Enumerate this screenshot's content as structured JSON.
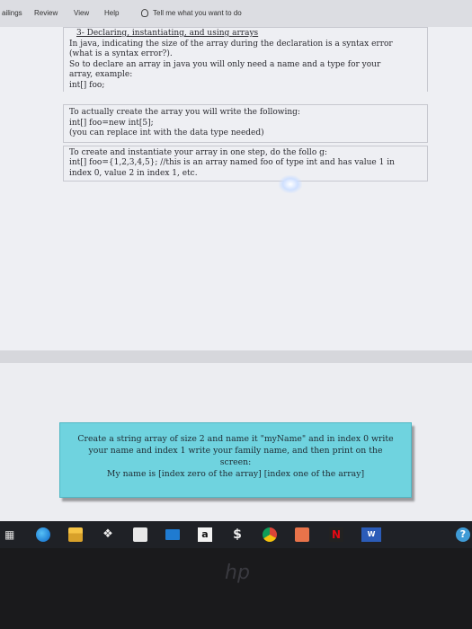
{
  "ribbon": {
    "tabs": [
      "ailings",
      "Review",
      "View",
      "Help"
    ],
    "tell_me": "Tell me what you want to do"
  },
  "document": {
    "title": "3- Declaring, instantiating, and using arrays",
    "para1": [
      "In java, indicating the size of the array during the declaration is a syntax error",
      "(what is a syntax error?).",
      "So to declare an array in java you will only need a name and a type for your",
      "array, example:",
      "int[] foo;"
    ],
    "para2": [
      "To actually create the array you will write the following:",
      "int[] foo=new int[5];",
      "(you can replace int with the data type needed)"
    ],
    "para3": [
      "To create and instantiate your array in one step, do the follo    g:",
      "int[] foo={1,2,3,4,5}; //this is an array named foo of type int and has value 1 in",
      "index 0, value 2 in index 1, etc."
    ]
  },
  "task_box": {
    "lines": [
      "Create a string array of size 2 and name it \"myName\" and in index 0 write",
      "your name and index 1 write your family name, and then print on the",
      "screen:",
      "My name is [index zero of the array] [index one of the array]"
    ]
  },
  "taskbar": {
    "icons": [
      "task-view-icon",
      "edge-icon",
      "file-explorer-icon",
      "dropbox-icon",
      "store-icon",
      "mail-icon",
      "amazon-icon",
      "dollar-icon",
      "chrome-icon",
      "app-icon",
      "netflix-icon",
      "word-icon",
      "help-icon"
    ],
    "amazon_label": "a",
    "dollar_label": "$",
    "netflix_label": "N",
    "word_label": "W",
    "help_label": "?",
    "accent": "#0078d7"
  },
  "laptop": {
    "brand": "hp"
  }
}
